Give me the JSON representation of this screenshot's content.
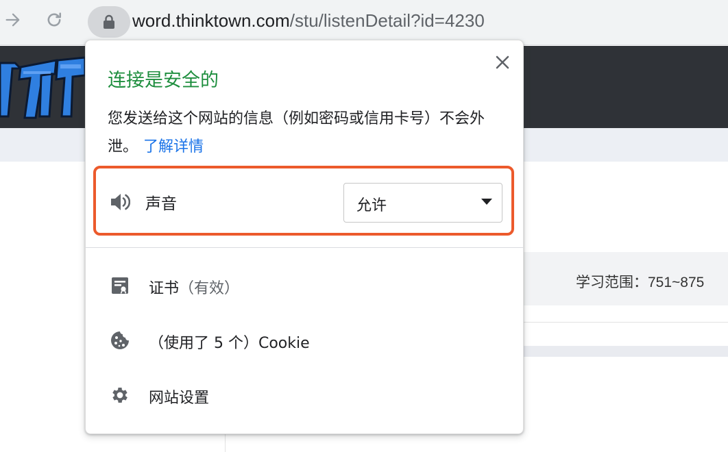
{
  "browser": {
    "url_host": "word.thinktown.com",
    "url_path": "/stu/listenDetail?id=4230"
  },
  "page": {
    "study_range": "学习范围：751~875"
  },
  "popup": {
    "title": "连接是安全的",
    "description": "您发送给这个网站的信息（例如密码或信用卡号）不会外泄。",
    "learn_more": "了解详情",
    "permission": {
      "label": "声音",
      "value": "允许"
    },
    "items": {
      "certificate_label": "证书",
      "certificate_status": "（有效）",
      "cookie_label": "（使用了 5 个）Cookie",
      "site_settings_label": "网站设置"
    }
  },
  "colors": {
    "secure_green": "#1e8e3e",
    "link_blue": "#1a73e8",
    "highlight_orange": "#ec5a2c"
  },
  "icons": [
    "forward-arrow-icon",
    "reload-icon",
    "lock-icon",
    "close-icon",
    "speaker-icon",
    "certificate-icon",
    "cookie-icon",
    "gear-icon"
  ]
}
